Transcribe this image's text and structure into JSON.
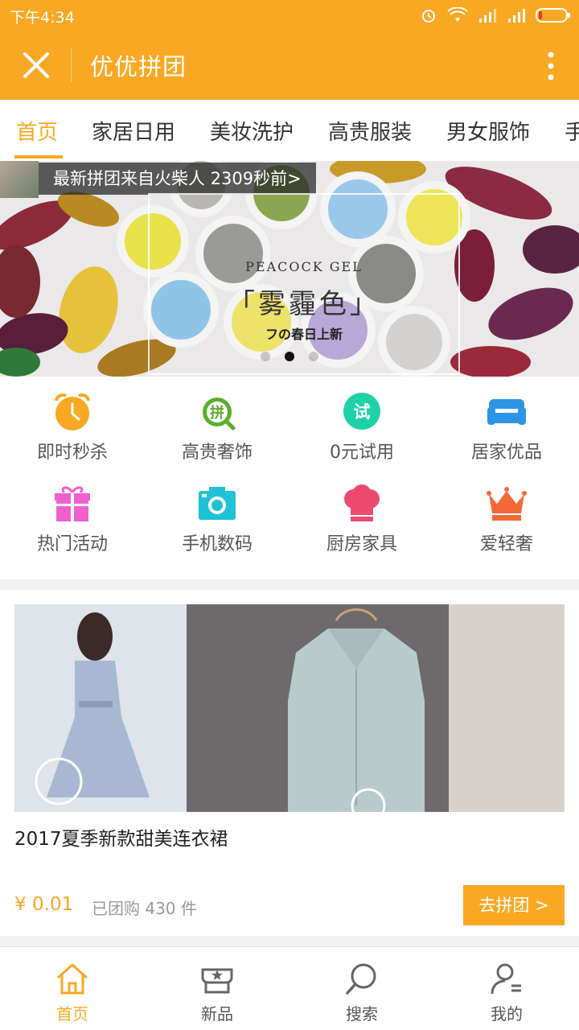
{
  "status_bar": {
    "time": "下午4:34"
  },
  "header": {
    "title": "优优拼团",
    "close_icon": "close-icon",
    "more_icon": "more-vertical-icon"
  },
  "tabs": [
    {
      "label": "首页",
      "active": true
    },
    {
      "label": "家居日用"
    },
    {
      "label": "美妆洗护"
    },
    {
      "label": "高贵服装"
    },
    {
      "label": "男女服饰"
    },
    {
      "label": "手"
    }
  ],
  "banner": {
    "ticker": "最新拼团来自火柴人 2309秒前>",
    "brand": "PEACOCK GEL",
    "main_text": "「雾霾色」",
    "sub_text": "フの春日上新",
    "active_slide": 2
  },
  "categories": [
    {
      "label": "即时秒杀",
      "icon": "alarm-clock-icon"
    },
    {
      "label": "高贵奢饰",
      "icon": "pin-badge-icon",
      "badge": "拼"
    },
    {
      "label": "0元试用",
      "icon": "trial-badge-icon",
      "badge": "试"
    },
    {
      "label": "居家优品",
      "icon": "sofa-icon"
    },
    {
      "label": "热门活动",
      "icon": "gift-icon"
    },
    {
      "label": "手机数码",
      "icon": "camera-icon"
    },
    {
      "label": "厨房家具",
      "icon": "chef-hat-icon"
    },
    {
      "label": "爱轻奢",
      "icon": "crown-icon"
    }
  ],
  "product": {
    "name": "2017夏季新款甜美连衣裙",
    "price": "¥ 0.01",
    "sold": "已团购 430 件",
    "button": "去拼团 >"
  },
  "bottom_nav": [
    {
      "label": "首页",
      "icon": "home-icon",
      "active": true
    },
    {
      "label": "新品",
      "icon": "new-product-icon"
    },
    {
      "label": "搜索",
      "icon": "search-icon"
    },
    {
      "label": "我的",
      "icon": "profile-icon"
    }
  ],
  "colors": {
    "accent": "#f8a823",
    "text": "#333333",
    "muted": "#999999"
  }
}
